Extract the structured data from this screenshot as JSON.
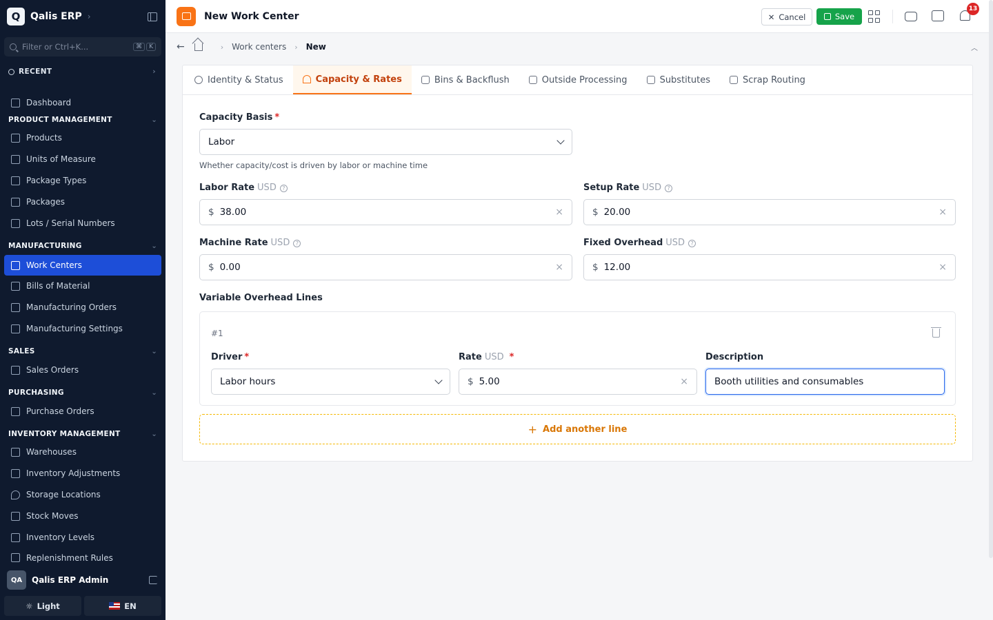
{
  "app": {
    "name": "Qalis ERP",
    "logo_letter": "Q",
    "filter_placeholder": "Filter or Ctrl+K...",
    "kbd_1": "⌘",
    "kbd_2": "K"
  },
  "sidebar": {
    "recent_label": "RECENT",
    "dashboard": "Dashboard",
    "sections": {
      "product_management": "PRODUCT MANAGEMENT",
      "manufacturing": "MANUFACTURING",
      "sales": "SALES",
      "purchasing": "PURCHASING",
      "inventory_management": "INVENTORY MANAGEMENT"
    },
    "items": {
      "products": "Products",
      "units_of_measure": "Units of Measure",
      "package_types": "Package Types",
      "packages": "Packages",
      "lots_serial_numbers": "Lots / Serial Numbers",
      "work_centers": "Work Centers",
      "bills_of_material": "Bills of Material",
      "manufacturing_orders": "Manufacturing Orders",
      "manufacturing_settings": "Manufacturing Settings",
      "sales_orders": "Sales Orders",
      "purchase_orders": "Purchase Orders",
      "warehouses": "Warehouses",
      "inventory_adjustments": "Inventory Adjustments",
      "storage_locations": "Storage Locations",
      "stock_moves": "Stock Moves",
      "inventory_levels": "Inventory Levels",
      "replenishment_rules": "Replenishment Rules"
    },
    "user": {
      "initials": "QA",
      "name": "Qalis ERP Admin"
    },
    "theme_label": "Light",
    "lang_label": "EN"
  },
  "header": {
    "title": "New Work Center",
    "cancel_label": "Cancel",
    "save_label": "Save",
    "notification_count": "13"
  },
  "breadcrumb": {
    "parent": "Work centers",
    "current": "New"
  },
  "tabs": {
    "identity": "Identity & Status",
    "capacity": "Capacity & Rates",
    "bins": "Bins & Backflush",
    "outside": "Outside Processing",
    "substitutes": "Substitutes",
    "scrap": "Scrap Routing"
  },
  "form": {
    "capacity_basis": {
      "label": "Capacity Basis",
      "required": "*",
      "value": "Labor",
      "hint": "Whether capacity/cost is driven by labor or machine time"
    },
    "currency_symbol": "$",
    "unit": "USD",
    "labor_rate": {
      "label": "Labor Rate",
      "value": "38.00"
    },
    "setup_rate": {
      "label": "Setup Rate",
      "value": "20.00"
    },
    "machine_rate": {
      "label": "Machine Rate",
      "value": "0.00"
    },
    "fixed_overhead": {
      "label": "Fixed Overhead",
      "value": "12.00"
    },
    "variable_overhead": {
      "label": "Variable Overhead Lines",
      "lines": [
        {
          "number": "#1",
          "driver_label": "Driver",
          "driver_value": "Labor hours",
          "rate_label": "Rate",
          "rate_value": "5.00",
          "description_label": "Description",
          "description_value": "Booth utilities and consumables"
        }
      ],
      "add_label": "Add another line"
    }
  }
}
